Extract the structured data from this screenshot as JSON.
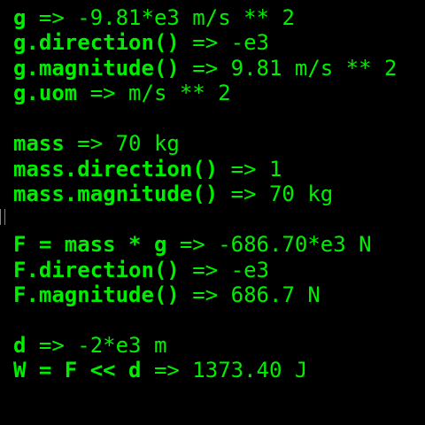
{
  "colors": {
    "background": "#000000",
    "text": "#00ee00"
  },
  "lines": [
    {
      "expr": "g",
      "res": " => -9.81*e3 m/s ** 2"
    },
    {
      "expr": "g.direction()",
      "res": " => -e3"
    },
    {
      "expr": "g.magnitude()",
      "res": " => 9.81 m/s ** 2"
    },
    {
      "expr": "g.uom",
      "res": " => m/s ** 2"
    },
    {
      "expr": "mass",
      "res": " => 70 kg"
    },
    {
      "expr": "mass.direction()",
      "res": " => 1"
    },
    {
      "expr": "mass.magnitude()",
      "res": " => 70 kg"
    },
    {
      "expr": "F = mass * g",
      "res": " => -686.70*e3 N"
    },
    {
      "expr": "F.direction()",
      "res": " => -e3"
    },
    {
      "expr": "F.magnitude()",
      "res": " => 686.7 N"
    },
    {
      "expr": "d",
      "res": " => -2*e3 m"
    },
    {
      "expr": "W = F << d",
      "res": " => 1373.40 J"
    }
  ]
}
